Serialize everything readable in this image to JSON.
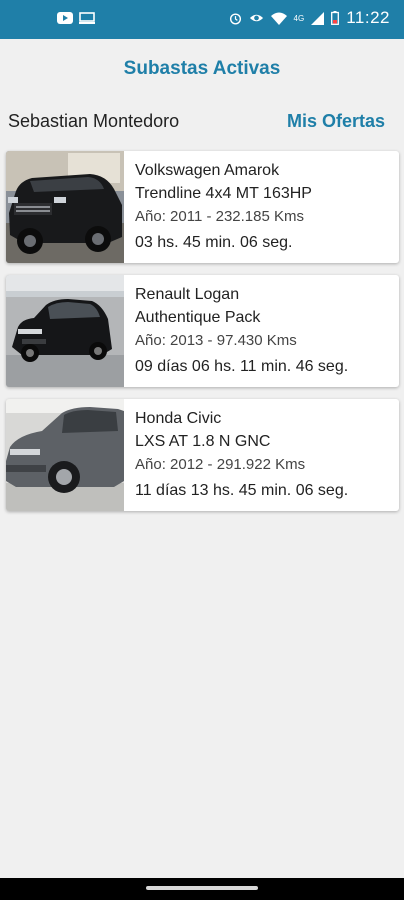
{
  "status_bar": {
    "time": "11:22",
    "network_label": "4G",
    "icons": [
      "youtube-icon",
      "cast-icon",
      "alarm-icon",
      "eye-icon",
      "wifi-icon",
      "signal-icon",
      "battery-icon"
    ],
    "background_color": "#1f7fa8"
  },
  "header": {
    "title": "Subastas Activas",
    "accent_color": "#1f7fa8"
  },
  "user_bar": {
    "name": "Sebastian Montedoro",
    "my_offers_label": "Mis Ofertas"
  },
  "auctions": [
    {
      "model": "Volkswagen Amarok",
      "version": "Trendline 4x4 MT 163HP",
      "info": "Año: 2011 - 232.185 Kms",
      "time_left": " 03 hs. 45 min. 06 seg.",
      "car_color": "black"
    },
    {
      "model": "Renault Logan",
      "version": "Authentique Pack",
      "info": "Año: 2013 - 97.430 Kms",
      "time_left": "09 días 06 hs. 11 min. 46 seg.",
      "car_color": "black"
    },
    {
      "model": "Honda Civic",
      "version": "LXS AT 1.8 N GNC",
      "info": "Año: 2012 - 291.922 Kms",
      "time_left": "11 días 13 hs. 45 min. 06 seg.",
      "car_color": "gray"
    }
  ]
}
